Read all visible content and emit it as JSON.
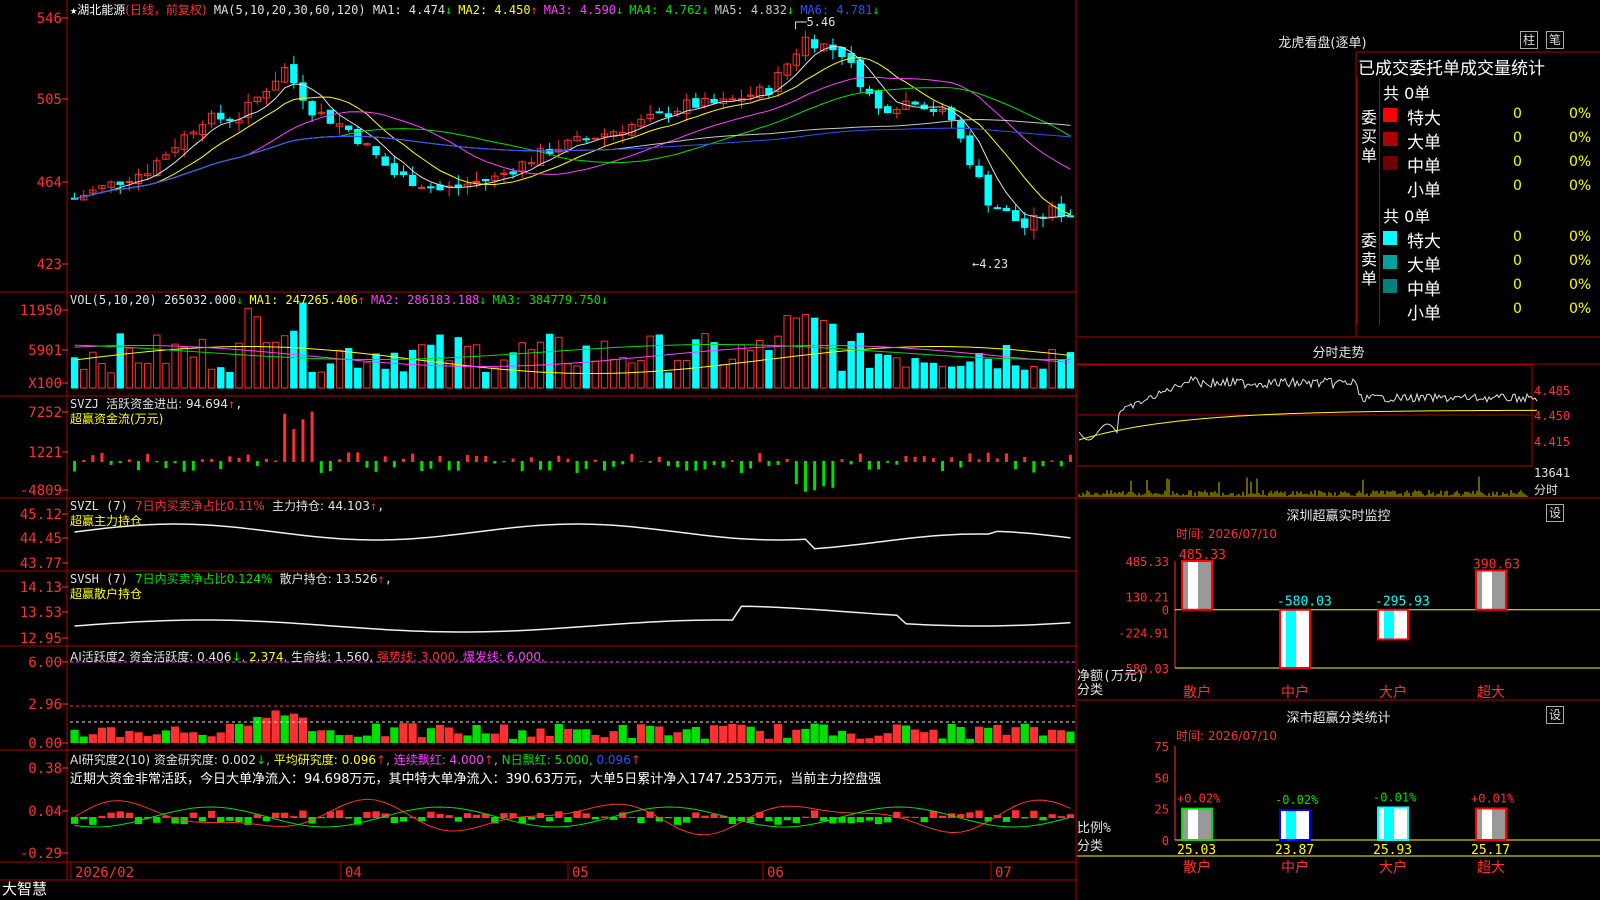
{
  "app": {
    "brand": "大智慧"
  },
  "stock": {
    "star": "★",
    "name": "湖北能源",
    "mode": "(日线，前复权)"
  },
  "ma_header": {
    "label": "MA(5,10,20,30,60,120)",
    "items": [
      {
        "text": "MA1: 4.474",
        "arrow": "↓",
        "color": "#e0e0e0",
        "arrow_color": "#00e000"
      },
      {
        "text": "MA2: 4.450",
        "arrow": "↑",
        "color": "#ffff00",
        "arrow_color": "#ff3030"
      },
      {
        "text": "MA3: 4.590",
        "arrow": "↓",
        "color": "#ff40ff",
        "arrow_color": "#00e000"
      },
      {
        "text": "MA4: 4.762",
        "arrow": "↓",
        "color": "#00e000",
        "arrow_color": "#00e000"
      },
      {
        "text": "MA5: 4.832",
        "arrow": "↓",
        "color": "#c8c8c8",
        "arrow_color": "#00e000"
      },
      {
        "text": "MA6: 4.781",
        "arrow": "↓",
        "color": "#3050ff",
        "arrow_color": "#00e000"
      }
    ]
  },
  "price_axis": [
    "546",
    "505",
    "464",
    "423"
  ],
  "price_annotations": {
    "high": "5.46",
    "low": "4.23"
  },
  "vol_header": {
    "label": "VOL(5,10,20)",
    "items": [
      {
        "text": "265032.000",
        "arrow": "↓",
        "color": "#e0e0e0",
        "arrow_color": "#00e000"
      },
      {
        "text": "MA1: 247265.406",
        "arrow": "↑",
        "color": "#ffff00",
        "arrow_color": "#ff3030"
      },
      {
        "text": "MA2: 286183.188",
        "arrow": "↓",
        "color": "#ff40ff",
        "arrow_color": "#00e000"
      },
      {
        "text": "MA3: 384779.750",
        "arrow": "↓",
        "color": "#00e000",
        "arrow_color": "#00e000"
      }
    ]
  },
  "vol_axis": [
    "11950",
    "5901",
    "X100"
  ],
  "svzj": {
    "label": "SVZJ",
    "line1": "活跃资金进出: 94.694",
    "arrow": "↑",
    "tail": ",",
    "line2": "超赢资金流(万元)",
    "axis": [
      "7252",
      "1221",
      "-4809"
    ]
  },
  "svzl": {
    "label": "SVZL (7)",
    "ratio": "7日内买卖净占比0.11%",
    "hold": "主力持仓: 44.103",
    "arrow": "↑",
    "tail": ",",
    "line2": "超赢主力持仓",
    "axis": [
      "45.12",
      "44.45",
      "43.77"
    ]
  },
  "svsh": {
    "label": "SVSH (7)",
    "ratio": "7日内买卖净占比0.124%",
    "hold": "散户持仓: 13.526",
    "arrow": "↑",
    "tail": ",",
    "line2": "超赢散户持仓",
    "axis": [
      "14.13",
      "13.53",
      "12.95"
    ]
  },
  "ai_active": {
    "label": "AI活跃度2",
    "activity": "资金活跃度: 0.406",
    "arrow1": "↓",
    "v2": "2.374",
    "life": "生命线: 1.560,",
    "strong": "强势线: 3.000,",
    "burst": "爆发线: 6.000,",
    "axis": [
      "6.00",
      "2.96",
      "0.00"
    ]
  },
  "ai_research": {
    "label": "AI研究度2(10)",
    "research": "资金研究度: 0.002",
    "arrow1": "↓",
    "avg": "平均研究度: 0.096",
    "arrow2": "↑",
    "streak": "连续飘红: 4.000",
    "arrow3": "↑",
    "nday": "N日飘红: 5.000,",
    "nval": "0.096",
    "arrow4": "↑",
    "summary": "近期大资金非常活跃，今日大单净流入：94.698万元，其中特大单净流入：390.63万元，大单5日累计净入1747.253万元，当前主力控盘强",
    "axis": [
      "0.38",
      "0.04",
      "-0.29"
    ]
  },
  "dates": [
    "2026/02",
    "04",
    "05",
    "06",
    "07"
  ],
  "dragon": {
    "title": "龙虎看盘(逐单)",
    "btn_bar": "柱",
    "btn_pen": "笔",
    "subtitle": "已成交委托单成交量统计",
    "buy": {
      "side": "委买单",
      "total": "共 0单",
      "rows": [
        {
          "label": "特大",
          "value": "0",
          "pct": "0%",
          "color": "#ff0000"
        },
        {
          "label": "大单",
          "value": "0",
          "pct": "0%",
          "color": "#b00000"
        },
        {
          "label": "中单",
          "value": "0",
          "pct": "0%",
          "color": "#700000"
        },
        {
          "label": "小单",
          "value": "0",
          "pct": "0%",
          "color": ""
        }
      ]
    },
    "sell": {
      "side": "委卖单",
      "total": "共 0单",
      "rows": [
        {
          "label": "特大",
          "value": "0",
          "pct": "0%",
          "color": "#00ffff"
        },
        {
          "label": "大单",
          "value": "0",
          "pct": "0%",
          "color": "#00a0a0"
        },
        {
          "label": "中单",
          "value": "0",
          "pct": "0%",
          "color": "#008080"
        },
        {
          "label": "小单",
          "value": "0",
          "pct": "0%",
          "color": ""
        }
      ]
    }
  },
  "intraday": {
    "title": "分时走势",
    "axis": [
      "4.485",
      "4.450",
      "4.415"
    ],
    "vol_label": "13641",
    "vol_unit": "分时"
  },
  "sz_monitor": {
    "title": "深圳超赢实时监控",
    "set": "设",
    "time": "时间: 2026/07/10",
    "axis": [
      "485.33",
      "130.21",
      "0",
      "-224.91",
      "-580.03"
    ],
    "y_label": "净额(万元)",
    "x_label": "分类",
    "bars": [
      {
        "cat": "散户",
        "value": 485.33,
        "label": "485.33"
      },
      {
        "cat": "中户",
        "value": -580.03,
        "label": "-580.03"
      },
      {
        "cat": "大户",
        "value": -295.93,
        "label": "-295.93"
      },
      {
        "cat": "超大",
        "value": 390.63,
        "label": "390.63"
      }
    ]
  },
  "sz_class": {
    "title": "深市超赢分类统计",
    "set": "设",
    "time": "时间: 2026/07/10",
    "axis": [
      "75",
      "50",
      "25",
      "0"
    ],
    "y_label": "比例%",
    "x_label": "分类",
    "bars": [
      {
        "cat": "散户",
        "value": 25.03,
        "label": "25.03",
        "delta": "+0.02%"
      },
      {
        "cat": "中户",
        "value": 23.87,
        "label": "23.87",
        "delta": "-0.02%"
      },
      {
        "cat": "大户",
        "value": 25.93,
        "label": "25.93",
        "delta": "-0.01%"
      },
      {
        "cat": "超大",
        "value": 25.17,
        "label": "25.17",
        "delta": "+0.01%"
      }
    ]
  },
  "colors": {
    "up": "#ff3030",
    "down": "#00ffff",
    "grid": "#b00000",
    "green": "#00e000",
    "yellow": "#ffff00",
    "magenta": "#ff40ff"
  }
}
